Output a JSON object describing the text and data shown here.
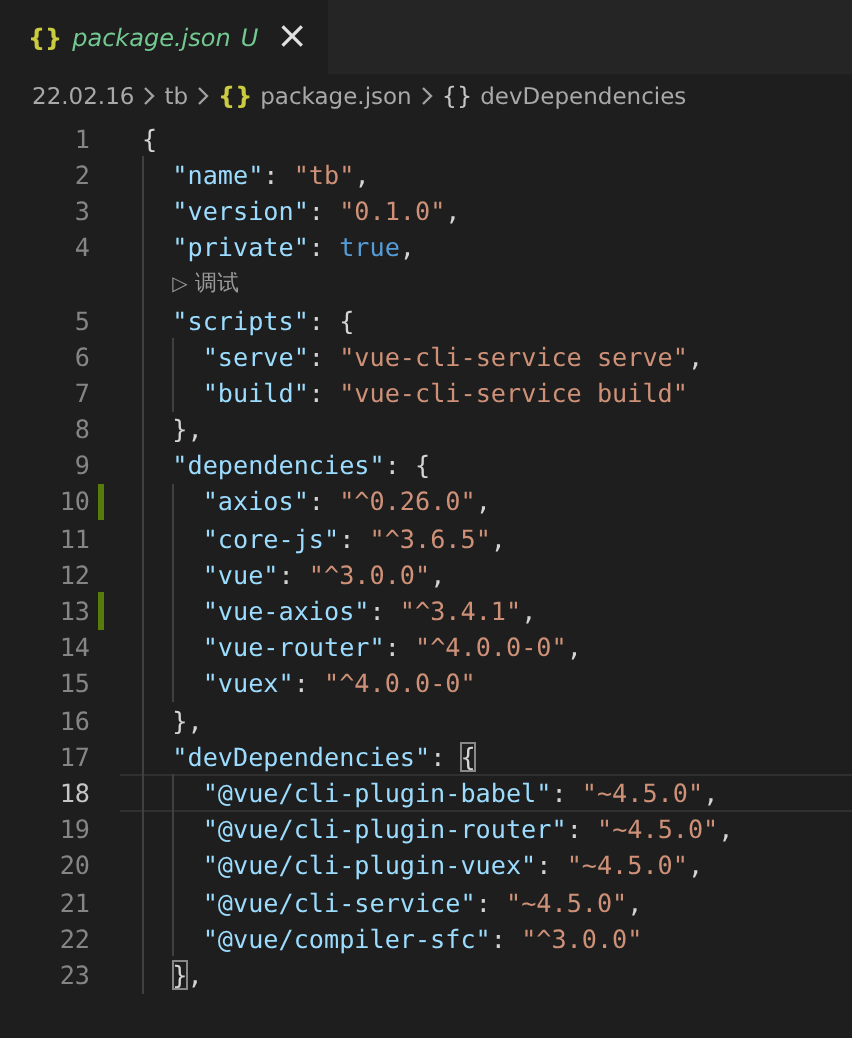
{
  "tab": {
    "icon": "{}",
    "label": "package.json",
    "status": "U",
    "close": "×",
    "selected": true
  },
  "breadcrumbs": [
    {
      "kind": "text",
      "label": "22.02.16"
    },
    {
      "kind": "text",
      "label": "tb"
    },
    {
      "kind": "file",
      "icon": "{}",
      "label": "package.json"
    },
    {
      "kind": "object",
      "icon": "{}",
      "label": "devDependencies"
    }
  ],
  "lines": [
    {
      "kind": "code",
      "number": "1",
      "modified": false,
      "current": false,
      "tokens": [
        {
          "kind": "punct",
          "text": "{"
        }
      ]
    },
    {
      "kind": "code",
      "number": "2",
      "modified": false,
      "current": false,
      "tokens": [
        {
          "kind": "key",
          "text": "  \"name\""
        },
        {
          "kind": "punct",
          "text": ": "
        },
        {
          "kind": "string",
          "text": "\"tb\""
        },
        {
          "kind": "punct",
          "text": ","
        }
      ]
    },
    {
      "kind": "code",
      "number": "3",
      "modified": false,
      "current": false,
      "tokens": [
        {
          "kind": "key",
          "text": "  \"version\""
        },
        {
          "kind": "punct",
          "text": ": "
        },
        {
          "kind": "string",
          "text": "\"0.1.0\""
        },
        {
          "kind": "punct",
          "text": ","
        }
      ]
    },
    {
      "kind": "code",
      "number": "4",
      "modified": false,
      "current": false,
      "tokens": [
        {
          "kind": "key",
          "text": "  \"private\""
        },
        {
          "kind": "punct",
          "text": ": "
        },
        {
          "kind": "bool",
          "text": "true"
        },
        {
          "kind": "punct",
          "text": ","
        }
      ]
    },
    {
      "kind": "codelens",
      "icon": "▷",
      "text": "调试"
    },
    {
      "kind": "code",
      "number": "5",
      "modified": false,
      "current": false,
      "tokens": [
        {
          "kind": "key",
          "text": "  \"scripts\""
        },
        {
          "kind": "punct",
          "text": ": {"
        }
      ]
    },
    {
      "kind": "code",
      "number": "6",
      "modified": false,
      "current": false,
      "tokens": [
        {
          "kind": "key",
          "text": "    \"serve\""
        },
        {
          "kind": "punct",
          "text": ": "
        },
        {
          "kind": "string",
          "text": "\"vue-cli-service serve\""
        },
        {
          "kind": "punct",
          "text": ","
        }
      ]
    },
    {
      "kind": "code",
      "number": "7",
      "modified": false,
      "current": false,
      "tokens": [
        {
          "kind": "key",
          "text": "    \"build\""
        },
        {
          "kind": "punct",
          "text": ": "
        },
        {
          "kind": "string",
          "text": "\"vue-cli-service build\""
        }
      ]
    },
    {
      "kind": "code",
      "number": "8",
      "modified": false,
      "current": false,
      "tokens": [
        {
          "kind": "punct",
          "text": "  },"
        }
      ]
    },
    {
      "kind": "code",
      "number": "9",
      "modified": false,
      "current": false,
      "tokens": [
        {
          "kind": "key",
          "text": "  \"dependencies\""
        },
        {
          "kind": "punct",
          "text": ": {"
        }
      ]
    },
    {
      "kind": "code",
      "number": "10",
      "modified": true,
      "current": false,
      "tokens": [
        {
          "kind": "key",
          "text": "    \"axios\""
        },
        {
          "kind": "punct",
          "text": ": "
        },
        {
          "kind": "string",
          "text": "\"^0.26.0\""
        },
        {
          "kind": "punct",
          "text": ","
        }
      ]
    },
    {
      "kind": "code",
      "number": "11",
      "modified": false,
      "current": false,
      "tokens": [
        {
          "kind": "key",
          "text": "    \"core-js\""
        },
        {
          "kind": "punct",
          "text": ": "
        },
        {
          "kind": "string",
          "text": "\"^3.6.5\""
        },
        {
          "kind": "punct",
          "text": ","
        }
      ]
    },
    {
      "kind": "code",
      "number": "12",
      "modified": false,
      "current": false,
      "tokens": [
        {
          "kind": "key",
          "text": "    \"vue\""
        },
        {
          "kind": "punct",
          "text": ": "
        },
        {
          "kind": "string",
          "text": "\"^3.0.0\""
        },
        {
          "kind": "punct",
          "text": ","
        }
      ]
    },
    {
      "kind": "code",
      "number": "13",
      "modified": true,
      "current": false,
      "tokens": [
        {
          "kind": "key",
          "text": "    \"vue-axios\""
        },
        {
          "kind": "punct",
          "text": ": "
        },
        {
          "kind": "string",
          "text": "\"^3.4.1\""
        },
        {
          "kind": "punct",
          "text": ","
        }
      ]
    },
    {
      "kind": "code",
      "number": "14",
      "modified": false,
      "current": false,
      "tokens": [
        {
          "kind": "key",
          "text": "    \"vue-router\""
        },
        {
          "kind": "punct",
          "text": ": "
        },
        {
          "kind": "string",
          "text": "\"^4.0.0-0\""
        },
        {
          "kind": "punct",
          "text": ","
        }
      ]
    },
    {
      "kind": "code",
      "number": "15",
      "modified": false,
      "current": false,
      "tokens": [
        {
          "kind": "key",
          "text": "    \"vuex\""
        },
        {
          "kind": "punct",
          "text": ": "
        },
        {
          "kind": "string",
          "text": "\"^4.0.0-0\""
        }
      ]
    },
    {
      "kind": "code",
      "number": "16",
      "modified": false,
      "current": false,
      "tokens": [
        {
          "kind": "punct",
          "text": "  },"
        }
      ]
    },
    {
      "kind": "code",
      "number": "17",
      "modified": false,
      "current": false,
      "tokens": [
        {
          "kind": "key",
          "text": "  \"devDependencies\""
        },
        {
          "kind": "punct",
          "text": ": "
        },
        {
          "kind": "bracket",
          "text": "{"
        }
      ]
    },
    {
      "kind": "code",
      "number": "18",
      "modified": false,
      "current": true,
      "tokens": [
        {
          "kind": "key",
          "text": "    \"@vue/cli-plugin-babel\""
        },
        {
          "kind": "punct",
          "text": ": "
        },
        {
          "kind": "string",
          "text": "\"~4.5.0\""
        },
        {
          "kind": "punct",
          "text": ","
        }
      ]
    },
    {
      "kind": "code",
      "number": "19",
      "modified": false,
      "current": false,
      "tokens": [
        {
          "kind": "key",
          "text": "    \"@vue/cli-plugin-router\""
        },
        {
          "kind": "punct",
          "text": ": "
        },
        {
          "kind": "string",
          "text": "\"~4.5.0\""
        },
        {
          "kind": "punct",
          "text": ","
        }
      ]
    },
    {
      "kind": "code",
      "number": "20",
      "modified": false,
      "current": false,
      "tokens": [
        {
          "kind": "key",
          "text": "    \"@vue/cli-plugin-vuex\""
        },
        {
          "kind": "punct",
          "text": ": "
        },
        {
          "kind": "string",
          "text": "\"~4.5.0\""
        },
        {
          "kind": "punct",
          "text": ","
        }
      ]
    },
    {
      "kind": "code",
      "number": "21",
      "modified": false,
      "current": false,
      "tokens": [
        {
          "kind": "key",
          "text": "    \"@vue/cli-service\""
        },
        {
          "kind": "punct",
          "text": ": "
        },
        {
          "kind": "string",
          "text": "\"~4.5.0\""
        },
        {
          "kind": "punct",
          "text": ","
        }
      ]
    },
    {
      "kind": "code",
      "number": "22",
      "modified": false,
      "current": false,
      "tokens": [
        {
          "kind": "key",
          "text": "    \"@vue/compiler-sfc\""
        },
        {
          "kind": "punct",
          "text": ": "
        },
        {
          "kind": "string",
          "text": "\"^3.0.0\""
        }
      ]
    },
    {
      "kind": "code",
      "number": "23",
      "modified": false,
      "current": false,
      "tokens": [
        {
          "kind": "bracket",
          "text": "  }"
        },
        {
          "kind": "punct",
          "text": ","
        }
      ]
    }
  ]
}
